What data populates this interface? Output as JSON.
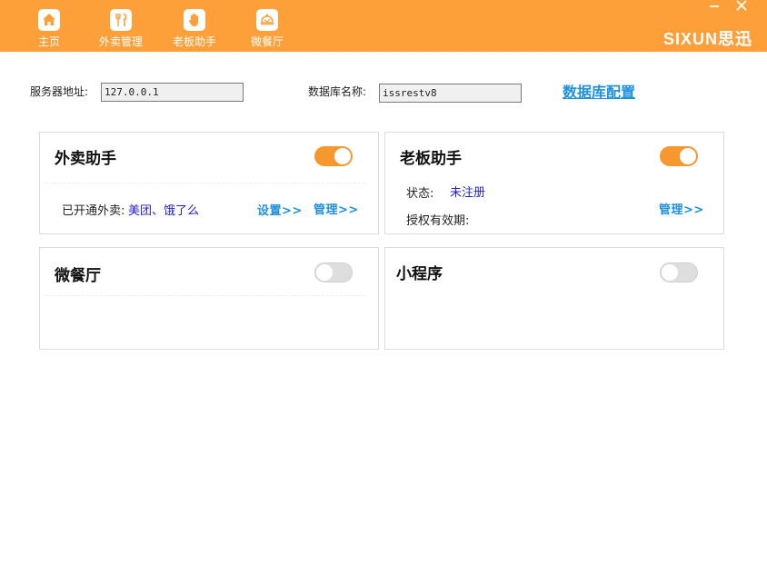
{
  "nav": {
    "items": [
      {
        "label": "主页",
        "icon": "home-icon"
      },
      {
        "label": "外卖管理",
        "icon": "fork-knife-icon"
      },
      {
        "label": "老板助手",
        "icon": "hand-icon"
      },
      {
        "label": "微餐厅",
        "icon": "restaurant-icon"
      }
    ]
  },
  "brand": {
    "name": "SIXUN思迅"
  },
  "config": {
    "server_label": "服务器地址:",
    "server_value": "127.0.0.1",
    "db_label": "数据库名称:",
    "db_value": "issrestv8",
    "db_config_link": "数据库配置"
  },
  "cards": {
    "takeout": {
      "title": "外卖助手",
      "enabled": true,
      "opened_label": "已开通外卖:",
      "opened_value": "美团、饿了么",
      "settings_link": "设置>>",
      "manage_link": "管理>>"
    },
    "boss": {
      "title": "老板助手",
      "enabled": true,
      "status_label": "状态:",
      "status_value": "未注册",
      "license_label": "授权有效期:",
      "manage_link": "管理>>"
    },
    "micro_restaurant": {
      "title": "微餐厅",
      "enabled": false
    },
    "mini_program": {
      "title": "小程序",
      "enabled": false
    }
  },
  "colors": {
    "topbar": "#fda03a",
    "accent_toggle": "#f7982e",
    "link_blue": "#1e90e0",
    "value_blue": "#2222cc"
  }
}
